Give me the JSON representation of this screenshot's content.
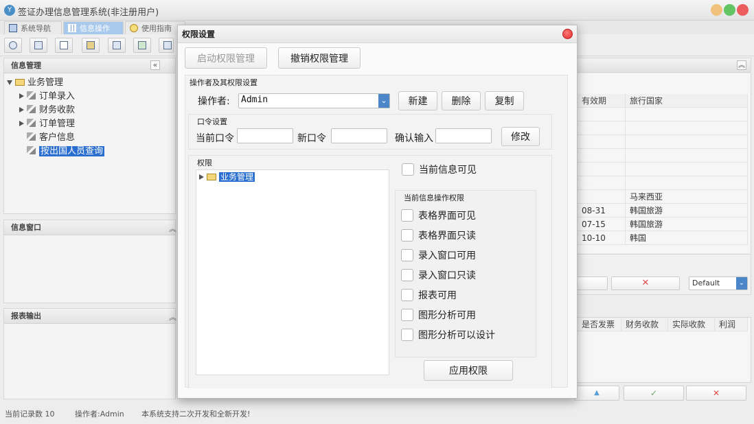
{
  "app": {
    "title": "签证办理信息管理系统(非注册用户)",
    "icon_glyph": "Y"
  },
  "window_controls": [
    {
      "name": "minimize-button",
      "color": "#f0c27b"
    },
    {
      "name": "maximize-button",
      "color": "#62c462"
    },
    {
      "name": "close-button",
      "color": "#ec5e5e"
    }
  ],
  "tabs": [
    {
      "label": "系统导航",
      "icon": "monitor-icon"
    },
    {
      "label": "信息操作",
      "icon": "grid-icon",
      "active": true
    },
    {
      "label": "使用指南",
      "icon": "clock-icon"
    }
  ],
  "left": {
    "info_title": "信息管理",
    "collapse_glyph": "«",
    "tree": {
      "root": "业务管理",
      "children": [
        {
          "label": "订单录入",
          "expandable": true
        },
        {
          "label": "财务收款",
          "expandable": true
        },
        {
          "label": "订单管理",
          "expandable": true
        },
        {
          "label": "客户信息",
          "expandable": false
        },
        {
          "label": "按出国人员查询",
          "expandable": false,
          "selected": true
        }
      ]
    },
    "window_title": "信息窗口",
    "report_title": "报表输出",
    "collapse_up_glyph": "︽"
  },
  "right": {
    "expand_glyph": "︽",
    "table": {
      "headers": [
        "有效期",
        "旅行国家"
      ],
      "rows": [
        [
          "",
          ""
        ],
        [
          "",
          ""
        ],
        [
          "",
          ""
        ],
        [
          "",
          ""
        ],
        [
          "",
          ""
        ],
        [
          "",
          ""
        ],
        [
          "",
          "马来西亚"
        ],
        [
          "08-31",
          "韩国旅游"
        ],
        [
          "07-15",
          "韩国旅游"
        ],
        [
          "10-10",
          "韩国"
        ]
      ]
    },
    "select_value": "Default",
    "delete_glyph": "✕",
    "sub_headers": [
      "是否发票",
      "财务收款",
      "实际收款",
      "利润"
    ],
    "bottom_glyphs": [
      "▲",
      "✓",
      "✕"
    ]
  },
  "status": {
    "records": "当前记录数 10",
    "operator": "操作者:Admin",
    "slogan": "本系统支持二次开发和全新开发!"
  },
  "dialog": {
    "title": "权限设置",
    "start_label": "启动权限管理",
    "revoke_label": "撤销权限管理",
    "operator_group": "操作者及其权限设置",
    "operator_label": "操作者:",
    "operator_value": "Admin",
    "new_label": "新建",
    "delete_label": "删除",
    "copy_label": "复制",
    "password_group": "口令设置",
    "current_pw_label": "当前口令",
    "new_pw_label": "新口令",
    "confirm_pw_label": "确认输入",
    "modify_label": "修改",
    "perm_group": "权限",
    "perm_tree_root": "业务管理",
    "info_visible": "当前信息可见",
    "ops_group": "当前信息操作权限",
    "ops": [
      "表格界面可见",
      "表格界面只读",
      "录入窗口可用",
      "录入窗口只读",
      "报表可用",
      "图形分析可用",
      "图形分析可以设计"
    ],
    "apply_label": "应用权限"
  }
}
